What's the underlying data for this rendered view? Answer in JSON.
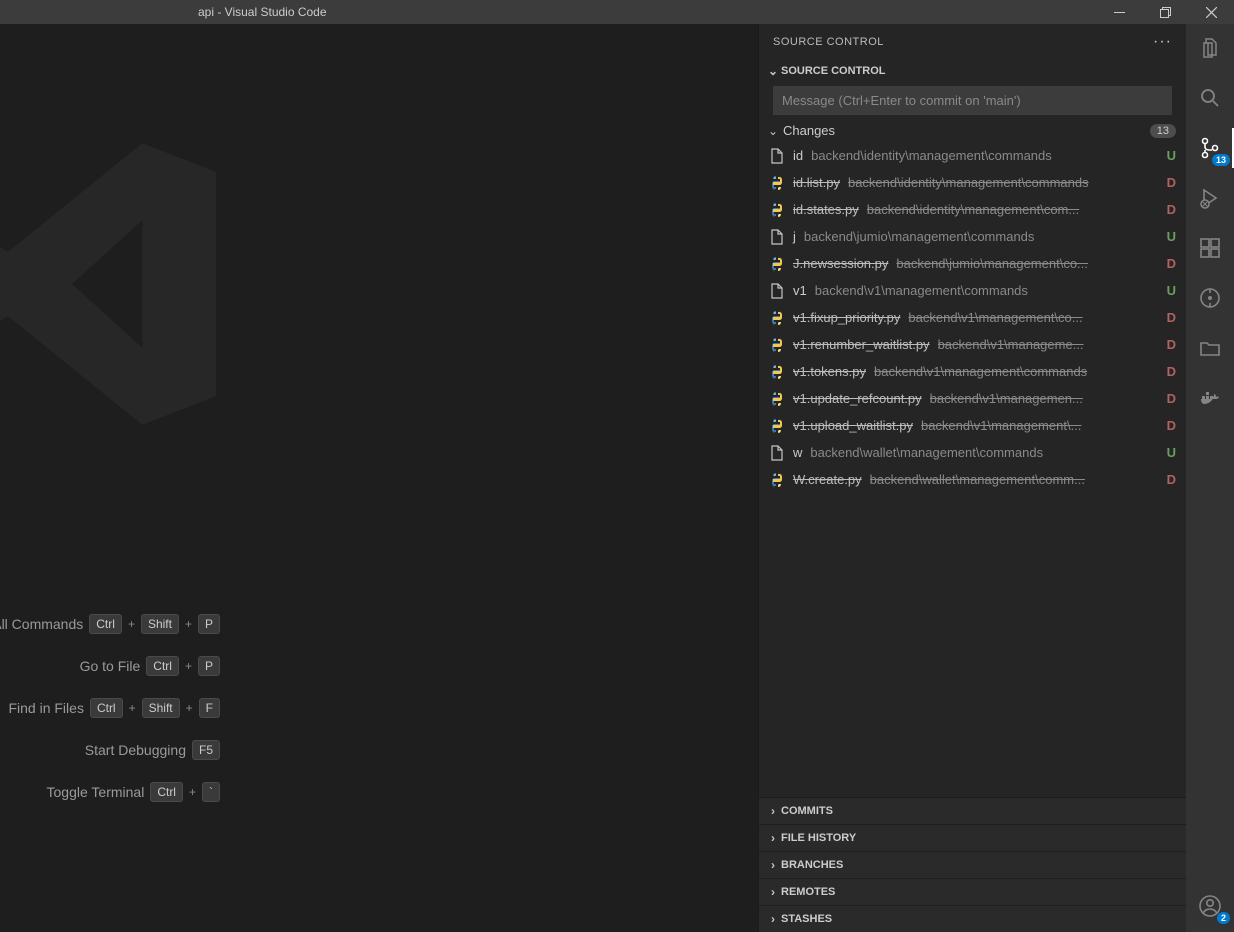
{
  "title": "api - Visual Studio Code",
  "scm": {
    "panel_title": "SOURCE CONTROL",
    "section_title": "SOURCE CONTROL",
    "commit_placeholder": "Message (Ctrl+Enter to commit on 'main')",
    "changes_label": "Changes",
    "changes_count": "13",
    "files": [
      {
        "icon": "file",
        "name": "id",
        "path": "backend\\identity\\management\\commands",
        "status": "U"
      },
      {
        "icon": "py",
        "name": "id.list.py",
        "path": "backend\\identity\\management\\commands",
        "status": "D"
      },
      {
        "icon": "py",
        "name": "id.states.py",
        "path": "backend\\identity\\management\\com...",
        "status": "D"
      },
      {
        "icon": "file",
        "name": "j",
        "path": "backend\\jumio\\management\\commands",
        "status": "U"
      },
      {
        "icon": "py",
        "name": "J.newsession.py",
        "path": "backend\\jumio\\management\\co...",
        "status": "D"
      },
      {
        "icon": "file",
        "name": "v1",
        "path": "backend\\v1\\management\\commands",
        "status": "U"
      },
      {
        "icon": "py",
        "name": "v1.fixup_priority.py",
        "path": "backend\\v1\\management\\co...",
        "status": "D"
      },
      {
        "icon": "py",
        "name": "v1.renumber_waitlist.py",
        "path": "backend\\v1\\manageme...",
        "status": "D"
      },
      {
        "icon": "py",
        "name": "v1.tokens.py",
        "path": "backend\\v1\\management\\commands",
        "status": "D"
      },
      {
        "icon": "py",
        "name": "v1.update_refcount.py",
        "path": "backend\\v1\\managemen...",
        "status": "D"
      },
      {
        "icon": "py",
        "name": "v1.upload_waitlist.py",
        "path": "backend\\v1\\management\\...",
        "status": "D"
      },
      {
        "icon": "file",
        "name": "w",
        "path": "backend\\wallet\\management\\commands",
        "status": "U"
      },
      {
        "icon": "py",
        "name": "W.create.py",
        "path": "backend\\wallet\\management\\comm...",
        "status": "D"
      }
    ],
    "sections": [
      {
        "label": "COMMITS"
      },
      {
        "label": "FILE HISTORY"
      },
      {
        "label": "BRANCHES"
      },
      {
        "label": "REMOTES"
      },
      {
        "label": "STASHES"
      }
    ]
  },
  "welcome": {
    "rows": [
      {
        "label": "Show All Commands",
        "keys": [
          "Ctrl",
          "Shift",
          "P"
        ]
      },
      {
        "label": "Go to File",
        "keys": [
          "Ctrl",
          "P"
        ]
      },
      {
        "label": "Find in Files",
        "keys": [
          "Ctrl",
          "Shift",
          "F"
        ]
      },
      {
        "label": "Start Debugging",
        "keys": [
          "F5"
        ]
      },
      {
        "label": "Toggle Terminal",
        "keys": [
          "Ctrl",
          "`"
        ]
      }
    ]
  },
  "activity": {
    "scm_badge": "13",
    "account_badge": "2"
  }
}
